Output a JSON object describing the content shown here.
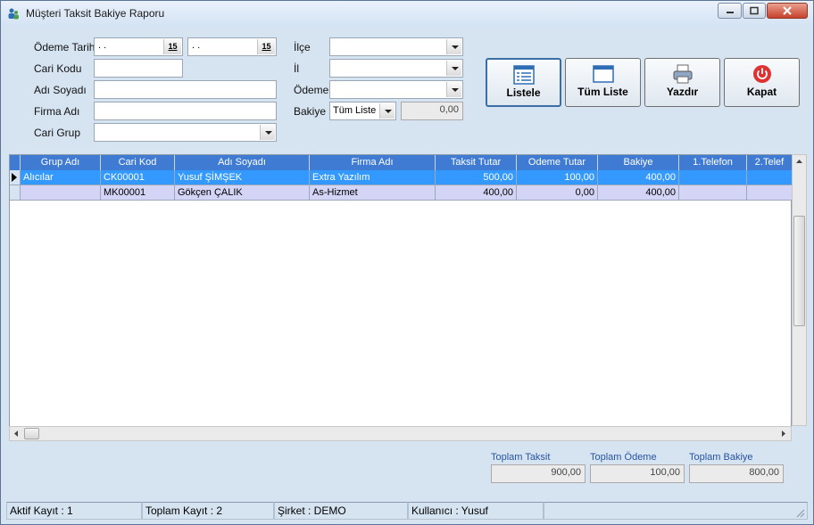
{
  "window": {
    "title": "Müşteri Taksit Bakiye Raporu"
  },
  "filters": {
    "odeme_tarihi_label": "Ödeme Tarihi",
    "date1": ". .",
    "date2": ". .",
    "date_btn": "15",
    "cari_kodu_label": "Cari Kodu",
    "adi_soyadi_label": "Adı Soyadı",
    "firma_adi_label": "Firma Adı",
    "cari_grup_label": "Cari Grup",
    "ilce_label": "İlçe",
    "il_label": "İl",
    "odeme_label": "Ödeme",
    "bakiye_label": "Bakiye",
    "bakiye_select": "Tüm Liste",
    "bakiye_value": "0,00"
  },
  "buttons": {
    "listele": "Listele",
    "tum_liste": "Tüm Liste",
    "yazdir": "Yazdır",
    "kapat": "Kapat"
  },
  "table": {
    "columns": [
      "Grup Adı",
      "Cari Kod",
      "Adı Soyadı",
      "Firma Adı",
      "Taksit Tutar",
      "Odeme Tutar",
      "Bakiye",
      "1.Telefon",
      "2.Telef"
    ],
    "rows": [
      [
        "Alıcılar",
        "CK00001",
        "Yusuf ŞİMŞEK",
        "Extra Yazılım",
        "500,00",
        "100,00",
        "400,00",
        "",
        ""
      ],
      [
        "",
        "MK00001",
        "Gökçen ÇALIK",
        "As-Hizmet",
        "400,00",
        "0,00",
        "400,00",
        "",
        ""
      ]
    ]
  },
  "totals": {
    "taksit_label": "Toplam Taksit",
    "taksit": "900,00",
    "odeme_label": "Toplam Ödeme",
    "odeme": "100,00",
    "bakiye_label": "Toplam Bakiye",
    "bakiye": "800,00"
  },
  "status": {
    "aktif": "Aktif Kayıt : 1",
    "toplam": "Toplam Kayıt : 2",
    "sirket": "Şirket : DEMO",
    "kullanici": "Kullanıcı : Yusuf"
  },
  "colors": {
    "selected_row": "#3399ff",
    "alt_row": "#d4d4f6",
    "header": "#3f7bd2"
  }
}
